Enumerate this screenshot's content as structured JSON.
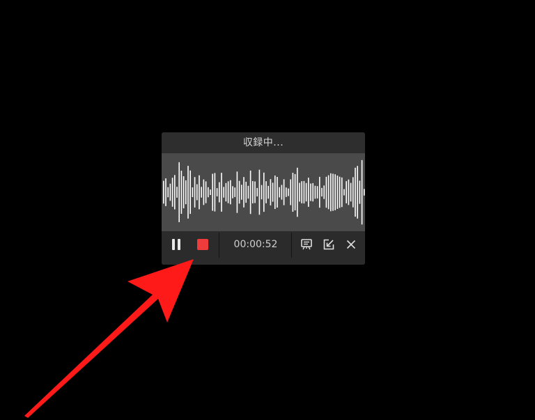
{
  "recorder": {
    "title": "収録中...",
    "timer": "00:00:52",
    "icons": {
      "pause": "pause-icon",
      "stop": "stop-icon",
      "subtitles": "subtitles-icon",
      "minimize": "minimize-icon",
      "close": "close-icon"
    }
  },
  "colors": {
    "background": "#000000",
    "panel": "#2b2b2b",
    "waveform_bg": "#4a4a4a",
    "waveform_bars": "#ffffff",
    "stop_accent": "#ee3b3b",
    "annotation_arrow": "#ff1a1a"
  }
}
